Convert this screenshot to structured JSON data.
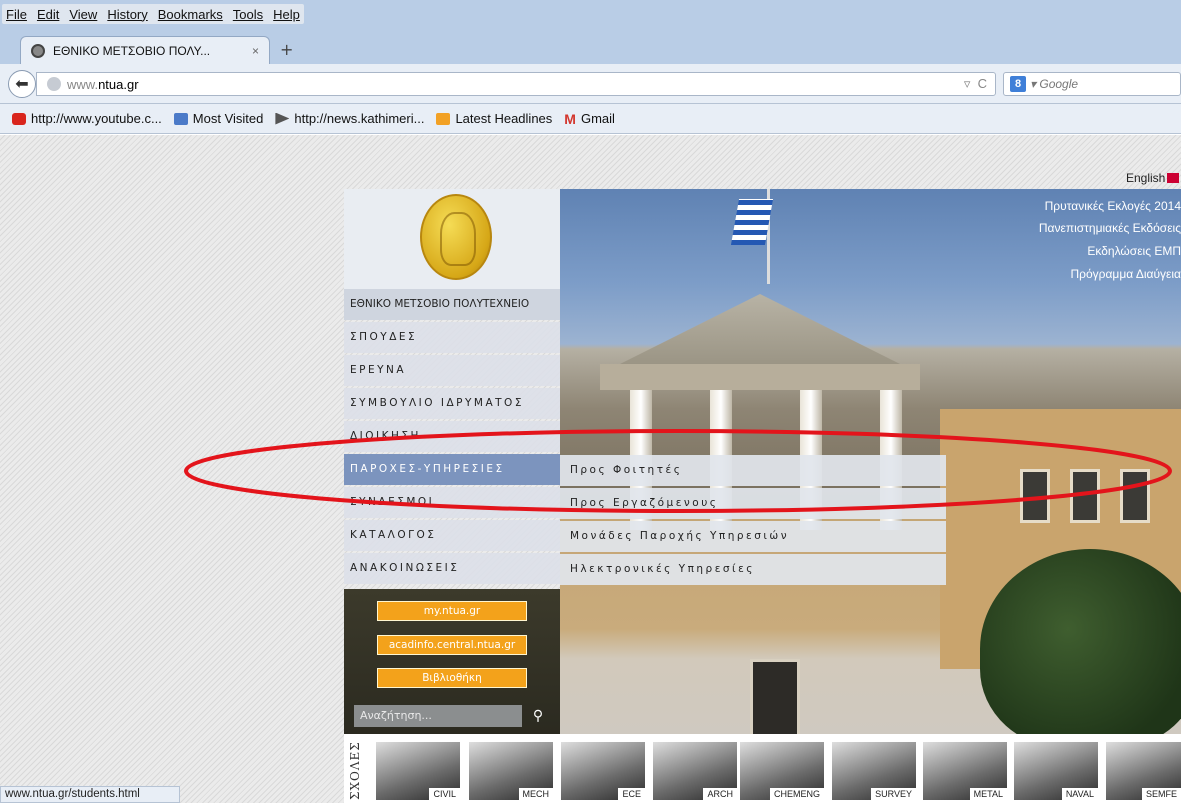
{
  "browser": {
    "menu": [
      "File",
      "Edit",
      "View",
      "History",
      "Bookmarks",
      "Tools",
      "Help"
    ],
    "tab_title": "ΕΘΝΙΚΟ ΜΕΤΣΟΒΙΟ ΠΟΛΥ...",
    "tab_close": "×",
    "new_tab": "+",
    "url_prefix": "www.",
    "url_host": "ntua.gr",
    "search_engine_label": "Google",
    "status_text": "www.ntua.gr/students.html"
  },
  "bookmarks": [
    {
      "label": "http://www.youtube.c...",
      "icon": "youtube-icon"
    },
    {
      "label": "Most Visited",
      "icon": "most-visited-icon"
    },
    {
      "label": "http://news.kathimeri...",
      "icon": "kathimerini-icon"
    },
    {
      "label": "Latest Headlines",
      "icon": "rss-icon"
    },
    {
      "label": "Gmail",
      "icon": "gmail-icon"
    }
  ],
  "site": {
    "language_link": "English",
    "top_links": [
      "Πρυτανικές Εκλογές 2014",
      "Πανεπιστημιακές Εκδόσεις",
      "Εκδηλώσεις ΕΜΠ",
      "Πρόγραμμα Διαύγεια"
    ],
    "menu": [
      "ΕΘΝΙΚΟ ΜΕΤΣΟΒΙΟ ΠΟΛΥΤΕΧΝΕΙΟ",
      "ΣΠΟΥΔΕΣ",
      "ΕΡΕΥΝΑ",
      "ΣΥΜΒΟΥΛΙΟ ΙΔΡΥΜΑΤΟΣ",
      "ΔΙΟΙΚΗΣΗ",
      "ΠΑΡΟΧΕΣ-ΥΠΗΡΕΣΙΕΣ",
      "ΣΥΝΔΕΣΜΟΙ",
      "ΚΑΤΑΛΟΓΟΣ",
      "ΑΝΑΚΟΙΝΩΣΕΙΣ"
    ],
    "submenu": [
      "Προς Φοιτητές",
      "Προς Εργαζόμενους",
      "Μονάδες Παροχής Υπηρεσιών",
      "Ηλεκτρονικές Υπηρεσίες"
    ],
    "quick_links": [
      "my.ntua.gr",
      "acadinfo.central.ntua.gr",
      "Βιβλιοθήκη"
    ],
    "search_placeholder": "Αναζήτηση...",
    "schools_label": "ΣΧΟΛΕΣ",
    "schools": [
      "CIVIL",
      "MECH",
      "ECE",
      "ARCH",
      "CHEMENG",
      "SURVEY",
      "METAL",
      "NAVAL",
      "SEMFE"
    ]
  },
  "colors": {
    "menu_active": "#7c94be",
    "quick_button": "#f3a21b",
    "annotation_ellipse": "#e3141b"
  }
}
